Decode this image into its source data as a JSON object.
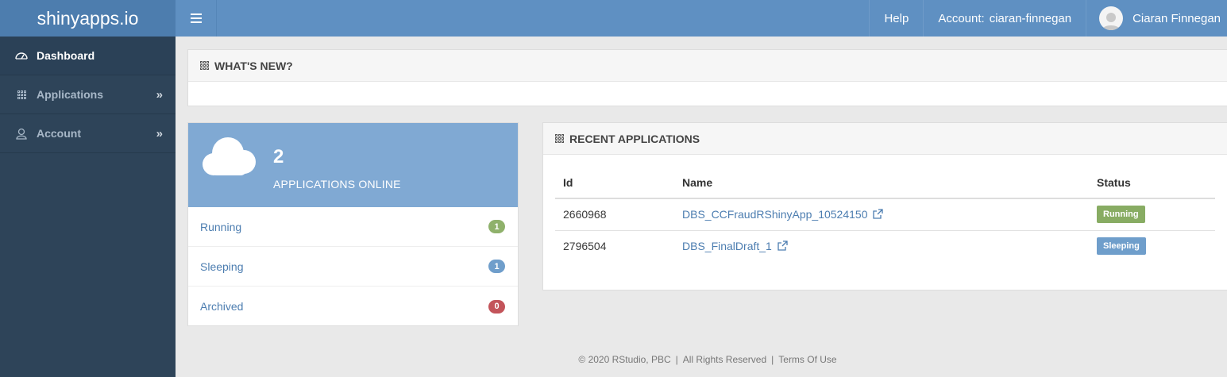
{
  "topbar": {
    "brand": "shinyapps.io",
    "help": "Help",
    "account_label": "Account:",
    "account_name": "ciaran-finnegan",
    "user_name": "Ciaran Finnegan"
  },
  "sidebar": {
    "items": [
      {
        "label": "Dashboard",
        "icon": "dashboard-icon"
      },
      {
        "label": "Applications",
        "icon": "grid-icon"
      },
      {
        "label": "Account",
        "icon": "user-icon"
      }
    ]
  },
  "whats_new": {
    "title": "WHAT'S NEW?"
  },
  "stats": {
    "count": "2",
    "label": "APPLICATIONS ONLINE",
    "rows": [
      {
        "label": "Running",
        "count": "1",
        "color": "#8fb16b"
      },
      {
        "label": "Sleeping",
        "count": "1",
        "color": "#6f9ecb"
      },
      {
        "label": "Archived",
        "count": "0",
        "color": "#c3545a"
      }
    ]
  },
  "recent": {
    "title": "RECENT APPLICATIONS",
    "headers": [
      "Id",
      "Name",
      "Status"
    ],
    "rows": [
      {
        "id": "2660968",
        "name": "DBS_CCFraudRShinyApp_10524150",
        "status": "Running"
      },
      {
        "id": "2796504",
        "name": "DBS_FinalDraft_1",
        "status": "Sleeping"
      }
    ]
  },
  "footer": {
    "copyright": "© 2020 RStudio, PBC",
    "rights": "All Rights Reserved",
    "terms": "Terms Of Use"
  },
  "colors": {
    "topbar": "#5f90c2",
    "brand_bg": "#4d7dae",
    "sidebar": "#2e4459",
    "stats_header": "#80a9d3"
  }
}
